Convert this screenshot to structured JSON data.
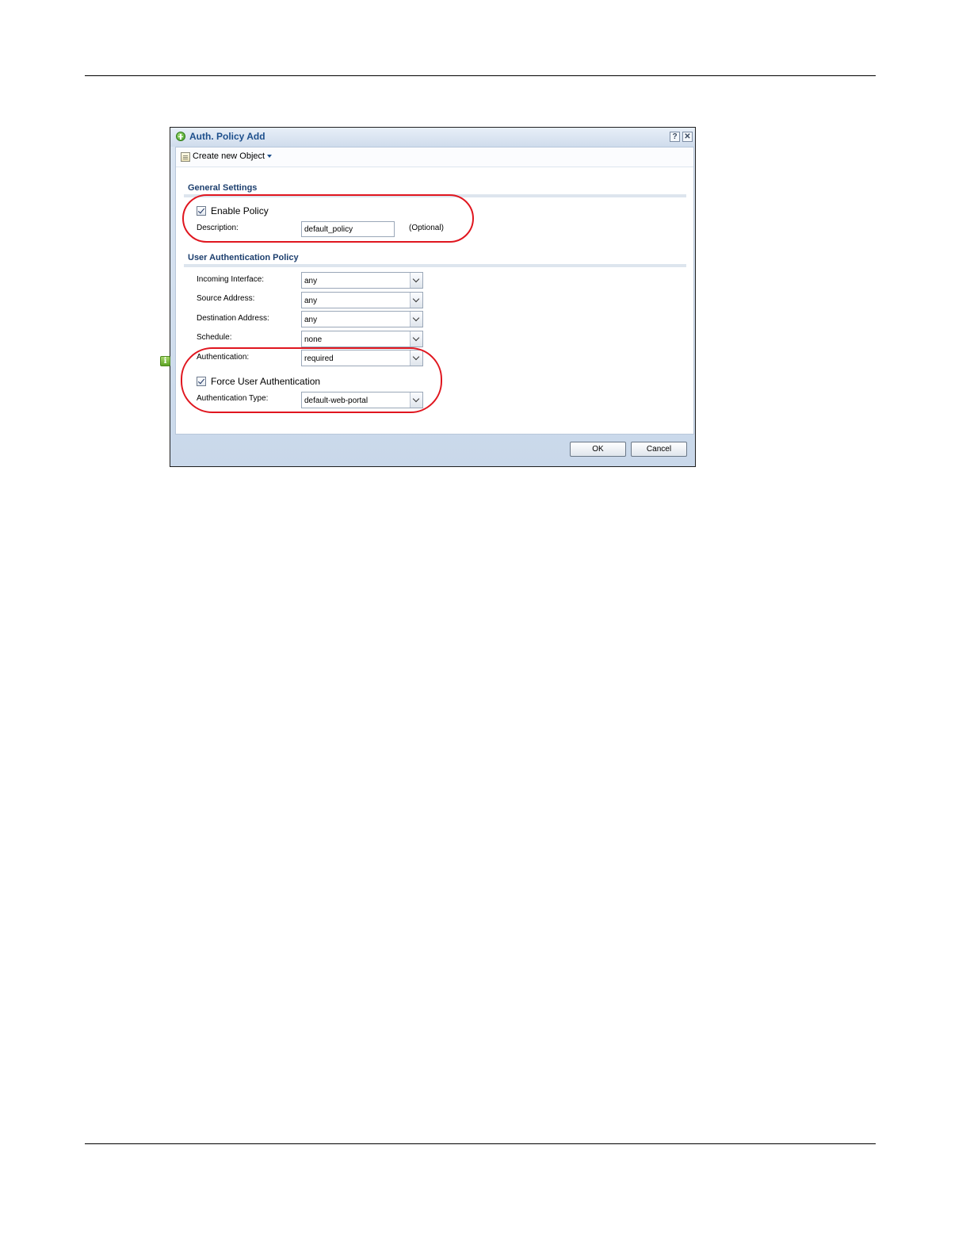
{
  "dialog": {
    "title": "Auth. Policy Add",
    "help_label": "?",
    "close_label": "✕"
  },
  "toolbar": {
    "create_object_label": "Create new Object"
  },
  "general_settings": {
    "title": "General Settings",
    "enable_policy_label": "Enable Policy",
    "enable_policy_checked": true,
    "description_label": "Description:",
    "description_value": "default_policy",
    "optional_label": "(Optional)"
  },
  "user_auth_policy": {
    "title": "User Authentication Policy",
    "incoming_interface_label": "Incoming Interface:",
    "incoming_interface_value": "any",
    "source_address_label": "Source Address:",
    "source_address_value": "any",
    "destination_address_label": "Destination Address:",
    "destination_address_value": "any",
    "schedule_label": "Schedule:",
    "schedule_value": "none",
    "authentication_label": "Authentication:",
    "authentication_value": "required",
    "force_user_auth_label": "Force User Authentication",
    "force_user_auth_checked": true,
    "info_icon_glyph": "i",
    "authentication_type_label": "Authentication Type:",
    "authentication_type_value": "default-web-portal"
  },
  "buttons": {
    "ok_label": "OK",
    "cancel_label": "Cancel"
  },
  "colors": {
    "highlight": "#e0161f",
    "title_text": "#1d4f8c",
    "section_title": "#1d3f6e"
  }
}
